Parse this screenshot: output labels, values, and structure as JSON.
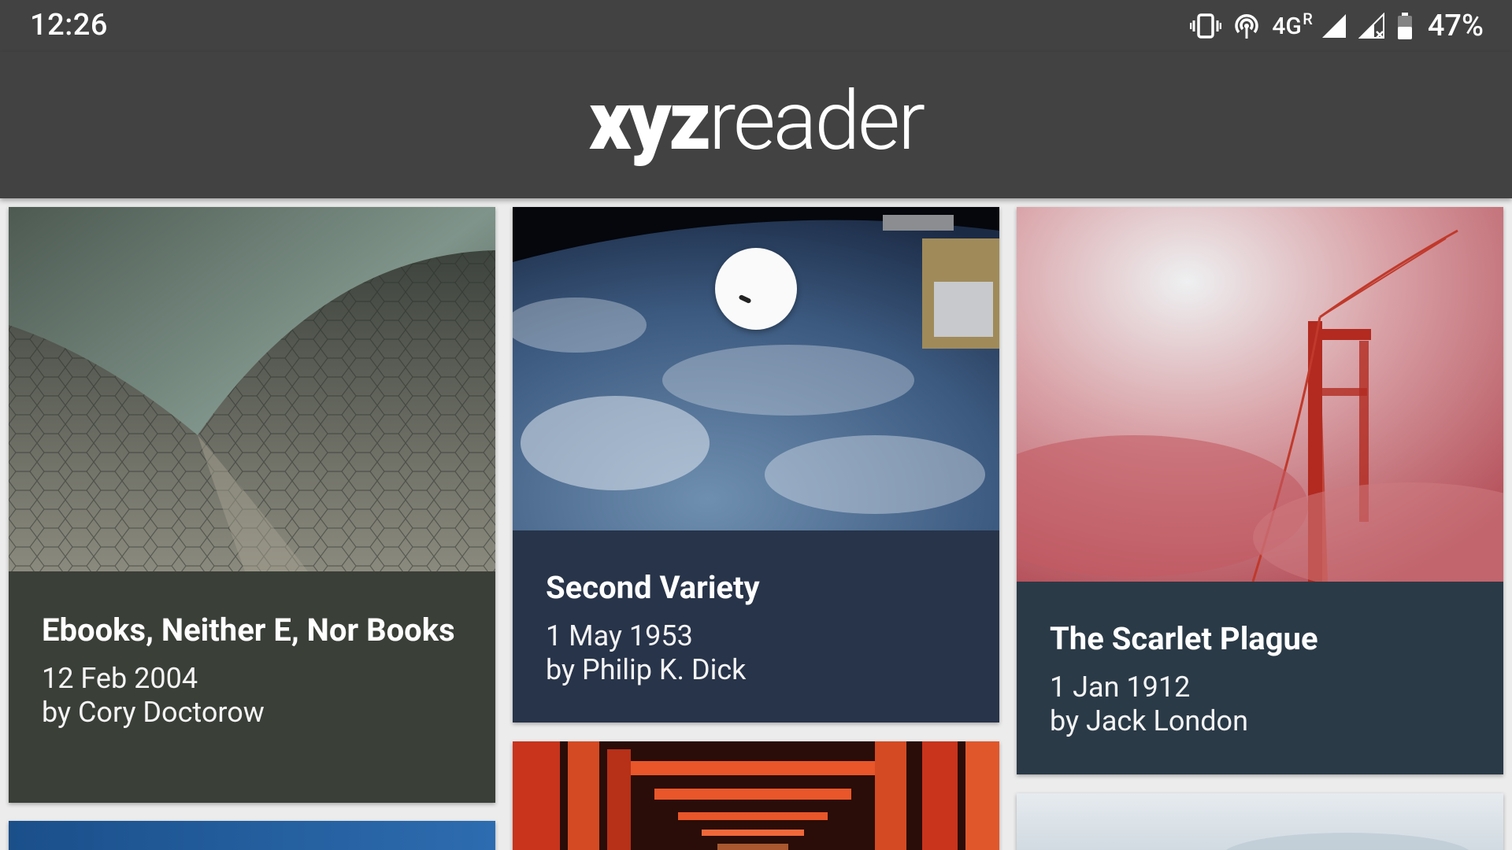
{
  "status_bar": {
    "time": "12:26",
    "network_type": "4G",
    "roaming": "R",
    "battery_percent": "47%",
    "icons": [
      "vibrate-icon",
      "hotspot-icon",
      "signal-icon",
      "no-signal-icon",
      "battery-icon"
    ]
  },
  "app_bar": {
    "logo_bold": "xyz",
    "logo_light": "reader"
  },
  "articles": [
    {
      "title": "Ebooks, Neither E, Nor Books",
      "date": "12 Feb 2004",
      "author": "by Cory Doctorow",
      "image": "opera-house-roof",
      "color": "#3a3f38"
    },
    {
      "title": "Second Variety",
      "date": "1 May 1953",
      "author": "by Philip K. Dick",
      "image": "earth-from-space",
      "color": "#283449"
    },
    {
      "title": "The Scarlet Plague",
      "date": "1 Jan 1912",
      "author": "by Jack London",
      "image": "golden-gate-fog",
      "color": "#2b3a47"
    }
  ],
  "partial_cards": [
    "blue-sky",
    "red-torii-gates",
    "pale-sky"
  ],
  "loading": true
}
